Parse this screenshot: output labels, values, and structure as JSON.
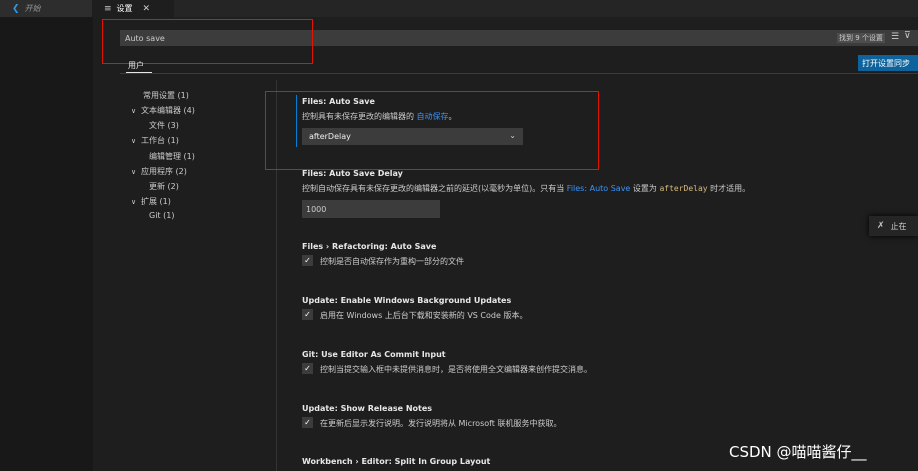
{
  "tabs": {
    "start_label": "开始",
    "settings_label": "设置"
  },
  "search": {
    "value": "Auto save",
    "result_count": "找到 9 个设置"
  },
  "scope": {
    "user_tab": "用户",
    "sync_button": "打开设置同步"
  },
  "toc": [
    {
      "label": "常用设置 (1)"
    },
    {
      "label": "文本编辑器 (4)"
    },
    {
      "label": "文件 (3)"
    },
    {
      "label": "工作台 (1)"
    },
    {
      "label": "编辑管理 (1)"
    },
    {
      "label": "应用程序 (2)"
    },
    {
      "label": "更新 (2)"
    },
    {
      "label": "扩展 (1)"
    },
    {
      "label": "Git (1)"
    }
  ],
  "settings": {
    "auto_save": {
      "title": "Files: Auto Save",
      "desc_prefix": "控制具有未保存更改的编辑器的 ",
      "desc_link": "自动保存",
      "desc_suffix": "。",
      "value": "afterDelay"
    },
    "auto_save_delay": {
      "title": "Files: Auto Save Delay",
      "desc_prefix": "控制自动保存具有未保存更改的编辑器之前的延迟(以毫秒为单位)。只有当 ",
      "desc_link": "Files: Auto Save",
      "desc_mid": " 设置为 ",
      "desc_code": "afterDelay",
      "desc_suffix": " 时才适用。",
      "value": "1000"
    },
    "refactoring_auto_save": {
      "title": "Files › Refactoring: Auto Save",
      "desc": "控制是否自动保存作为重构一部分的文件",
      "checked": true
    },
    "windows_bg_updates": {
      "title": "Update: Enable Windows Background Updates",
      "desc": "启用在 Windows 上后台下载和安装新的 VS Code 版本。",
      "checked": true
    },
    "git_commit_input": {
      "title": "Git: Use Editor As Commit Input",
      "desc": "控制当提交输入框中未提供消息时，是否将使用全文编辑器来创作提交消息。",
      "checked": true
    },
    "release_notes": {
      "title": "Update: Show Release Notes",
      "desc": "在更新后显示发行说明。发行说明将从 Microsoft 联机服务中获取。",
      "checked": true
    },
    "split_in_group": {
      "title": "Workbench › Editor: Split In Group Layout"
    }
  },
  "notification": {
    "text": "止在"
  },
  "watermark": "CSDN @喵喵酱仔__"
}
